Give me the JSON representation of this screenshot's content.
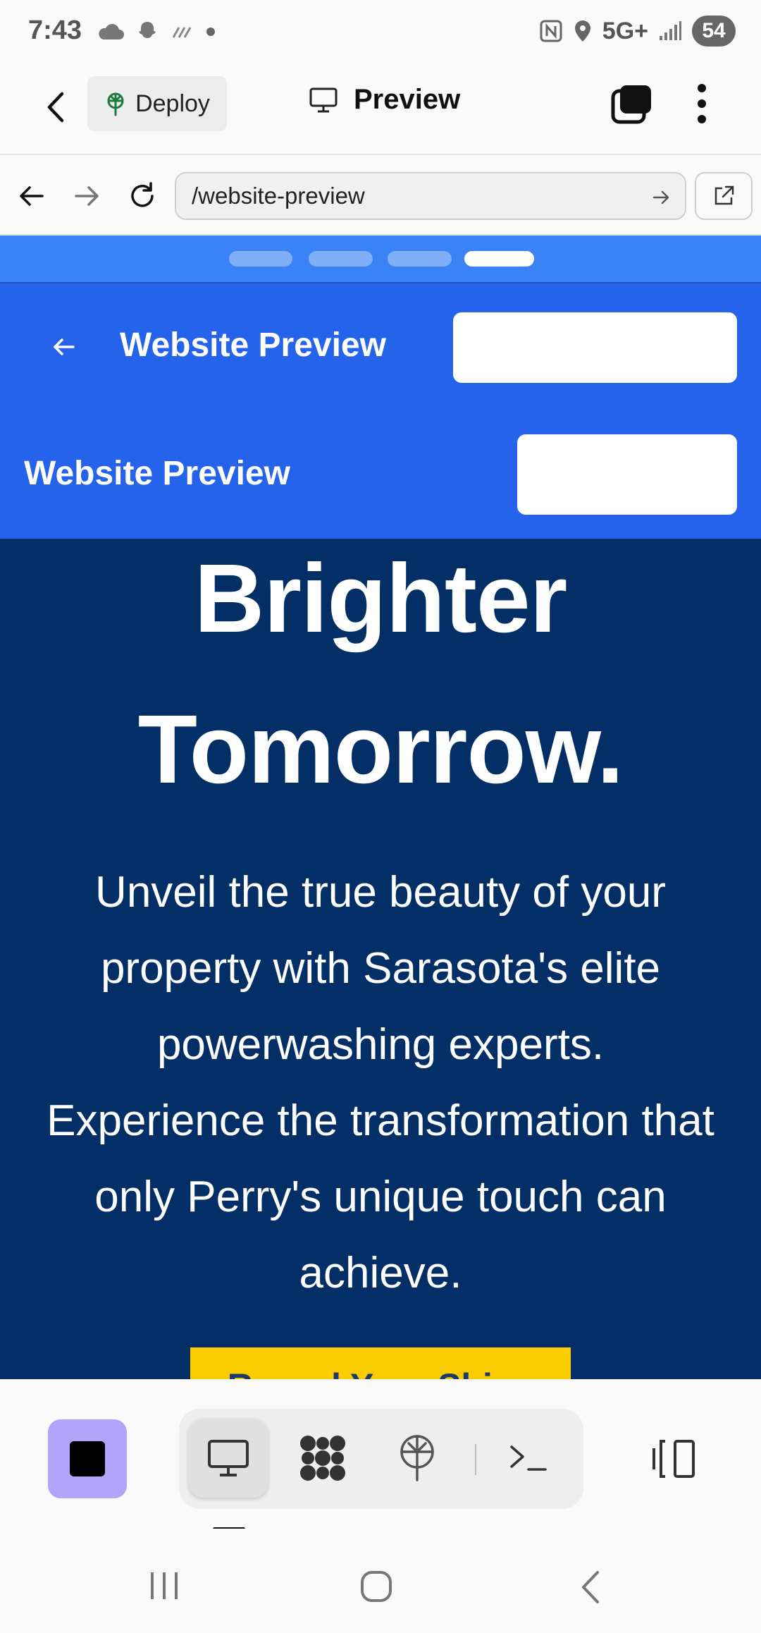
{
  "status_bar": {
    "time": "7:43",
    "network": "5G+",
    "battery": "54",
    "icons_left": [
      "cloud-icon",
      "snapchat-icon",
      "rain-icon",
      "dot-icon"
    ],
    "icons_right": [
      "nfc-icon",
      "location-icon",
      "signal-icon",
      "battery-icon"
    ]
  },
  "app_header": {
    "deploy_label": "Deploy",
    "preview_label": "Preview"
  },
  "url_bar": {
    "url": "/website-preview"
  },
  "site": {
    "progress_segments": 4,
    "active_segment": 4,
    "header_title": "Website Preview",
    "subheader_title": "Website Preview",
    "hero_line1": "Brighter",
    "hero_line2": "Tomorrow.",
    "hero_paragraph": "Unveil the true beauty of your property with Sarasota's elite powerwashing experts. Experience the transformation that only Perry's unique touch can achieve.",
    "cta_label": "Reveal Your Shine"
  },
  "colors": {
    "site_primary": "#2563eb",
    "hero_bg": "#032f66",
    "cta": "#fbcc00",
    "stop_button": "#b2a4fb"
  },
  "toolbar": {
    "active_tool": "preview"
  }
}
